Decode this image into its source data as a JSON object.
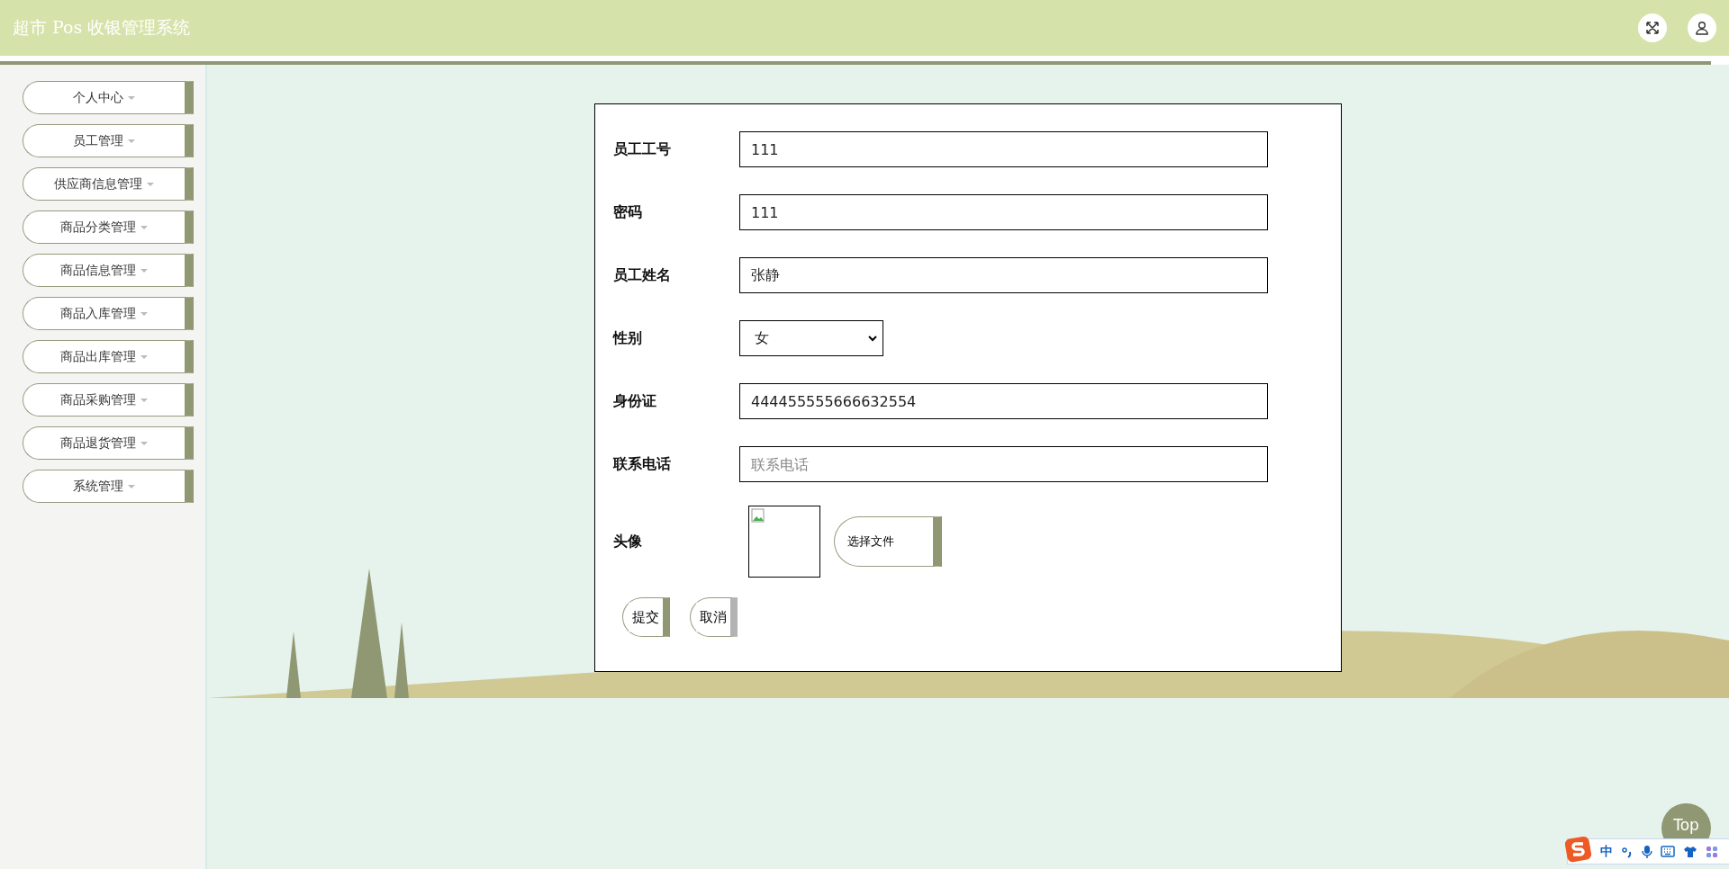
{
  "header": {
    "title": "超市 Pos 收银管理系统"
  },
  "sidebar": {
    "items": [
      {
        "label": "个人中心"
      },
      {
        "label": "员工管理"
      },
      {
        "label": "供应商信息管理"
      },
      {
        "label": "商品分类管理"
      },
      {
        "label": "商品信息管理"
      },
      {
        "label": "商品入库管理"
      },
      {
        "label": "商品出库管理"
      },
      {
        "label": "商品采购管理"
      },
      {
        "label": "商品退货管理"
      },
      {
        "label": "系统管理"
      }
    ]
  },
  "form": {
    "fields": [
      {
        "kind": "text",
        "label": "员工工号",
        "value": "111"
      },
      {
        "kind": "text",
        "label": "密码",
        "value": "111"
      },
      {
        "kind": "text",
        "label": "员工姓名",
        "value": "张静"
      },
      {
        "kind": "select",
        "label": "性别",
        "value": "女"
      },
      {
        "kind": "text",
        "label": "身份证",
        "value": "444455555666632554"
      },
      {
        "kind": "text",
        "label": "联系电话",
        "placeholder": "联系电话"
      },
      {
        "kind": "file",
        "label": "头像",
        "button": "选择文件"
      }
    ],
    "buttons": [
      {
        "kind": "primary",
        "label": "提交"
      },
      {
        "kind": "secondary",
        "label": "取消"
      }
    ]
  },
  "top_button": {
    "label": "Top"
  },
  "ime_bar": {
    "mode": "中"
  }
}
